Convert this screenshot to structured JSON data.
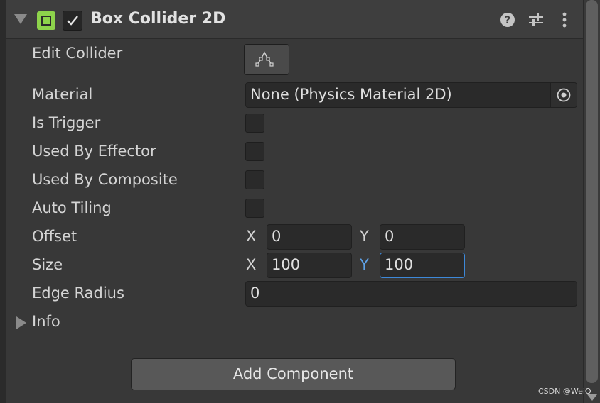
{
  "component": {
    "title": "Box Collider 2D",
    "enabled": true
  },
  "icons": {
    "fold": "triangle-down-icon",
    "component": "box-collider-2d-icon",
    "help": "question-circle-icon",
    "presets": "sliders-icon",
    "menu": "kebab-menu-icon",
    "edit_collider": "polygon-edit-icon",
    "object_picker": "target-circle-icon"
  },
  "fields": {
    "edit_collider": {
      "label": "Edit Collider"
    },
    "material": {
      "label": "Material",
      "value": "None (Physics Material 2D)"
    },
    "is_trigger": {
      "label": "Is Trigger",
      "checked": false
    },
    "used_by_effector": {
      "label": "Used By Effector",
      "checked": false
    },
    "used_by_composite": {
      "label": "Used By Composite",
      "checked": false
    },
    "auto_tiling": {
      "label": "Auto Tiling",
      "checked": false
    },
    "offset": {
      "label": "Offset",
      "x_label": "X",
      "x": "0",
      "y_label": "Y",
      "y": "0"
    },
    "size": {
      "label": "Size",
      "x_label": "X",
      "x": "100",
      "y_label": "Y",
      "y": "100"
    },
    "edge_radius": {
      "label": "Edge Radius",
      "value": "0"
    }
  },
  "info": {
    "label": "Info",
    "expanded": false
  },
  "add_component_label": "Add Component",
  "watermark": "CSDN @WeiQ",
  "colors": {
    "accent": "#3d88d8",
    "component_icon": "#8dd34b",
    "background": "#383838"
  }
}
